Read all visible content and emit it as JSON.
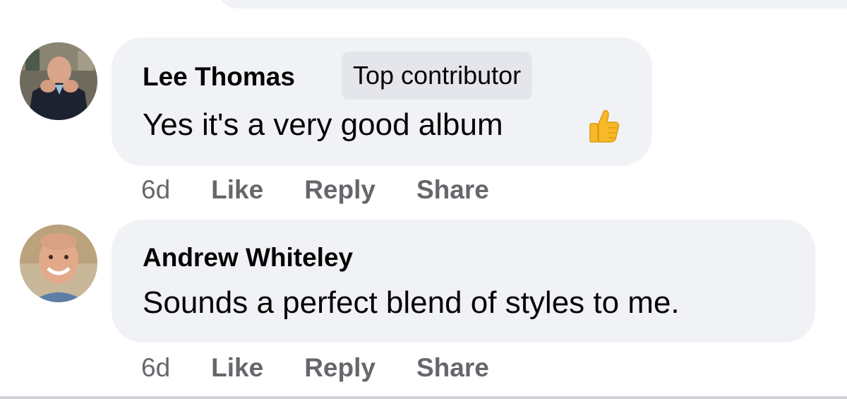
{
  "comments": [
    {
      "author": "Lee Thomas",
      "badge": "Top contributor",
      "text": "Yes it's a very good album",
      "emoji": "thumbs-up-icon",
      "time": "6d",
      "actions": {
        "like": "Like",
        "reply": "Reply",
        "share": "Share"
      }
    },
    {
      "author": "Andrew Whiteley",
      "text": "Sounds a perfect blend of styles to me.",
      "time": "6d",
      "actions": {
        "like": "Like",
        "reply": "Reply",
        "share": "Share"
      }
    }
  ],
  "colors": {
    "bubble": "#f0f2f5",
    "badge": "#e4e6eb",
    "secondary_text": "#65676b",
    "thumb": "#f7b928"
  }
}
